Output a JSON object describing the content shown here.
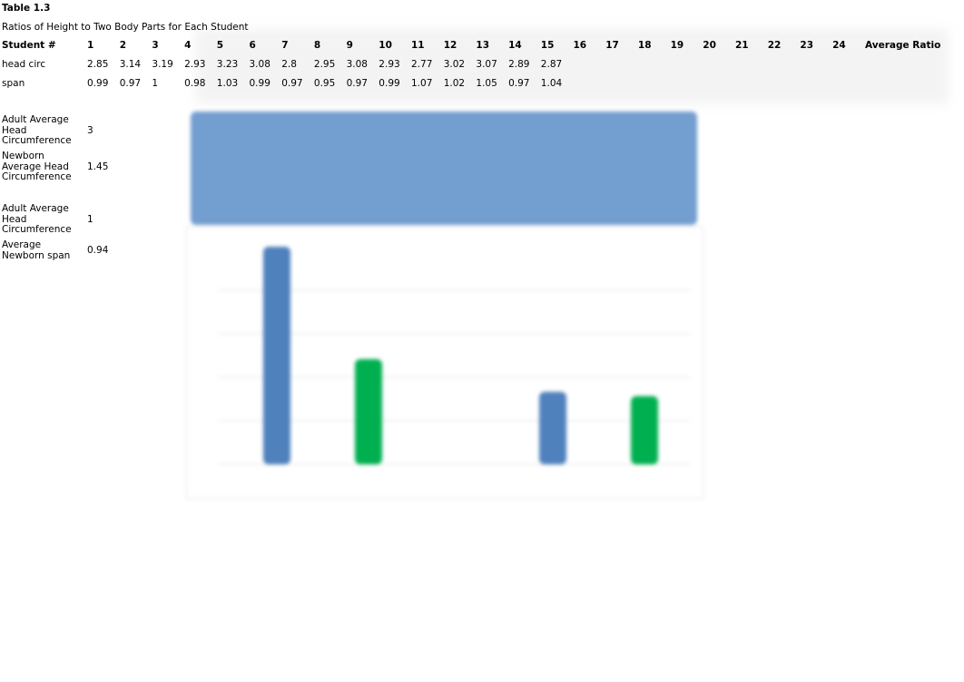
{
  "table": {
    "caption": "Table 1.3",
    "subtitle": "Ratios of Height to Two Body Parts for Each Student",
    "row_header": "Student #",
    "columns": [
      "1",
      "2",
      "3",
      "4",
      "5",
      "6",
      "7",
      "8",
      "9",
      "10",
      "11",
      "12",
      "13",
      "14",
      "15",
      "16",
      "17",
      "18",
      "19",
      "20",
      "21",
      "22",
      "23",
      "24"
    ],
    "average_header": "Average Ratio",
    "rows": [
      {
        "label": "head circ",
        "values": [
          "2.85",
          "3.14",
          "3.19",
          "2.93",
          "3.23",
          "3.08",
          "2.8",
          "2.95",
          "3.08",
          "2.93",
          "2.77",
          "3.02",
          "3.07",
          "2.89",
          "2.87"
        ]
      },
      {
        "label": "span",
        "values": [
          "0.99",
          "0.97",
          "1",
          "0.98",
          "1.03",
          "0.99",
          "0.97",
          "0.95",
          "0.97",
          "0.99",
          "1.07",
          "1.02",
          "1.05",
          "0.97",
          "1.04"
        ]
      }
    ]
  },
  "summary": [
    {
      "label": "Adult Average Head Circumference",
      "value": "3"
    },
    {
      "label": "Newborn Average Head Circumference",
      "value": "1.45"
    },
    {
      "label": "Adult Average Head Circumference",
      "value": "1"
    },
    {
      "label": "Average Newborn span",
      "value": "0.94"
    }
  ],
  "chart_data": {
    "type": "bar",
    "values": [
      3,
      1.45,
      1,
      0.94
    ],
    "colors": [
      "#4f81bd",
      "#00b050",
      "#4f81bd",
      "#00b050"
    ],
    "header_color": "#739ed0",
    "ylim": [
      0,
      3
    ],
    "grid": true
  }
}
